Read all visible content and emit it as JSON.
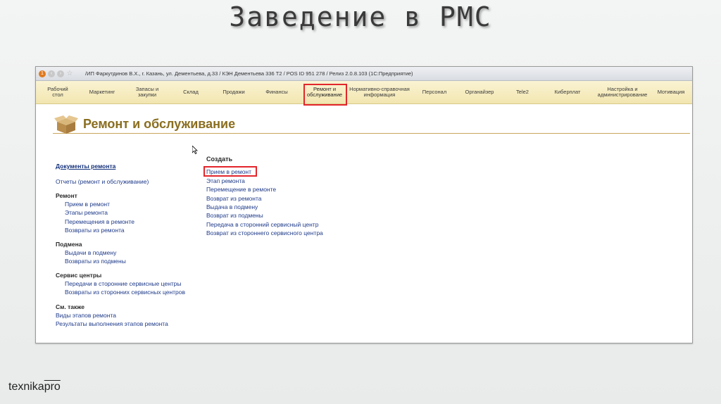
{
  "slide": {
    "title": "Заведение в РМС",
    "brand_main": "texnika",
    "brand_suffix": "pro"
  },
  "window": {
    "title": "/ИП Фаркутдинов В.Х., г. Казань, ул. Дементьева, д.33 / КЭН Дементьева 336 Т2 / POS ID 951 278 / Релиз 2.0.8.103 (1С:Предприятие)"
  },
  "sections": [
    {
      "label": "Рабочий\nстол"
    },
    {
      "label": "Маркетинг"
    },
    {
      "label": "Запасы и\nзакупки"
    },
    {
      "label": "Склад"
    },
    {
      "label": "Продажи"
    },
    {
      "label": "Финансы"
    },
    {
      "label": "Ремонт и\nобслуживание"
    },
    {
      "label": "Нормативно-справочная\nинформация"
    },
    {
      "label": "Персонал"
    },
    {
      "label": "Органайзер"
    },
    {
      "label": "Tele2"
    },
    {
      "label": "Киберплат"
    },
    {
      "label": "Настройка и\nадминистрирование"
    },
    {
      "label": "Мотивация"
    }
  ],
  "page": {
    "title": "Ремонт и обслуживание"
  },
  "nav": {
    "documents": "Документы ремонта",
    "reports": "Отчеты (ремонт и обслуживание)",
    "group_repair": "Ремонт",
    "repair_items": [
      "Прием в ремонт",
      "Этапы ремонта",
      "Перемещения в ремонте",
      "Возвраты из ремонта"
    ],
    "group_replace": "Подмена",
    "replace_items": [
      "Выдачи в подмену",
      "Возвраты из подмены"
    ],
    "group_service": "Сервис центры",
    "service_items": [
      "Передачи в сторонние сервисные центры",
      "Возвраты из сторонних сервисных центров"
    ],
    "group_see_also": "См. также",
    "see_also_items": [
      "Виды этапов ремонта",
      "Результаты выполнения этапов ремонта"
    ]
  },
  "create": {
    "title": "Создать",
    "items": [
      "Прием в ремонт",
      "Этап ремонта",
      "Перемещение в ремонте",
      "Возврат из ремонта",
      "Выдача в подмену",
      "Возврат из подмены",
      "Передача в сторонний сервисный центр",
      "Возврат из стороннего сервисного центра"
    ]
  },
  "colors": {
    "highlight": "#e2262b",
    "section_bar": "#f2e6b0",
    "page_title": "#8a6e1f",
    "link": "#1f3b8a"
  }
}
